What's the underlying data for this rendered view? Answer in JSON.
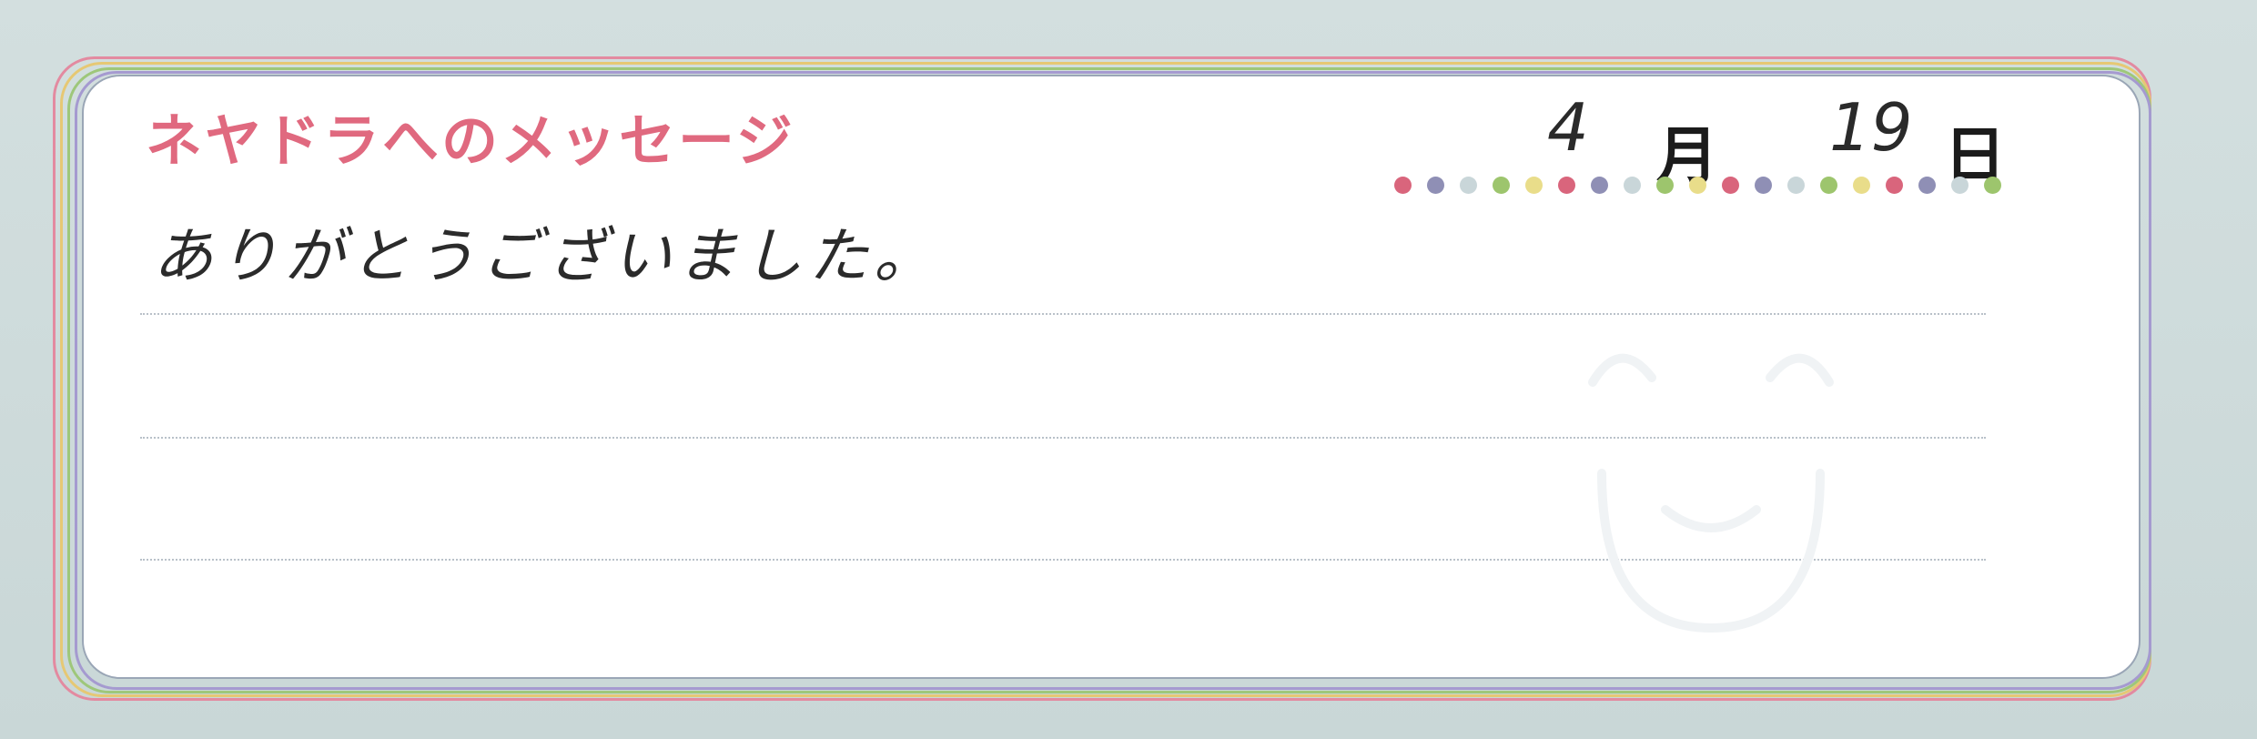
{
  "card": {
    "title": "ネヤドラへのメッセージ",
    "month_value": "4",
    "month_label": "月",
    "day_value": "19",
    "day_label": "日",
    "message": "ありがとうございました。"
  },
  "colors": {
    "background": "#cfdcdc",
    "title": "#e0697f",
    "border_pink": "#e38aa0",
    "border_yellow": "#e6c874",
    "border_green": "#9ec77a",
    "border_purple": "#a59ad0",
    "dot_colors": [
      "#d9657c",
      "#8f8fb5",
      "#c9d6d9",
      "#9dc56d",
      "#e9dd8a",
      "#d9657c",
      "#8f8fb5",
      "#c9d6d9",
      "#9dc56d",
      "#e9dd8a",
      "#d9657c",
      "#8f8fb5",
      "#c9d6d9",
      "#9dc56d",
      "#e9dd8a",
      "#d9657c",
      "#8f8fb5",
      "#c9d6d9",
      "#9dc56d"
    ]
  },
  "icons": {
    "watermark": "smiley-face-watermark-icon"
  }
}
